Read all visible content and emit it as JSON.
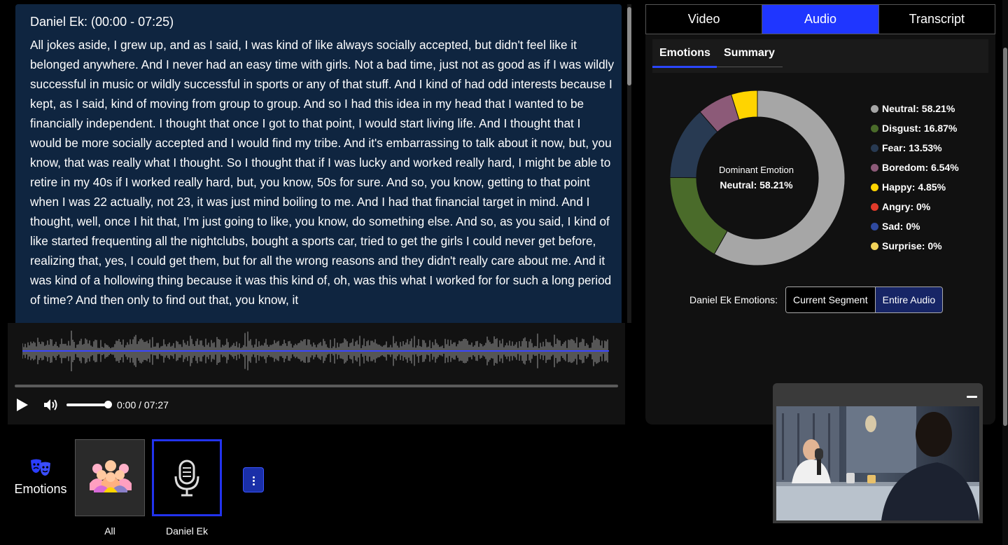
{
  "transcript": {
    "speaker_header": "Daniel Ek: (00:00 - 07:25)",
    "text": "All jokes aside, I grew up, and as I said, I was kind of like always socially accepted, but didn't feel like it belonged anywhere. And I never had an easy time with girls. Not a bad time, just not as good as if I was wildly successful in music or wildly successful in sports or any of that stuff. And I kind of had odd interests because I kept, as I said, kind of moving from group to group. And so I had this idea in my head that I wanted to be financially independent. I thought that once I got to that point, I would start living life. And I thought that I would be more socially accepted and I would find my tribe. And it's embarrassing to talk about it now, but, you know, that was really what I thought. So I thought that if I was lucky and worked really hard, I might be able to retire in my 40s if I worked really hard, but, you know, 50s for sure. And so, you know, getting to that point when I was 22 actually, not 23, it was just mind boiling to me. And I had that financial target in mind. And I thought, well, once I hit that, I'm just going to like, you know, do something else. And so, as you said, I kind of like started frequenting all the nightclubs, bought a sports car, tried to get the girls I could never get before, realizing that, yes, I could get them, but for all the wrong reasons and they didn't really care about me. And it was kind of a hollowing thing because it was this kind of, oh, was this what I worked for for such a long period of time? And then only to find out that, you know, it"
  },
  "player": {
    "time": "0:00 / 07:27",
    "volume_fraction": 1.0,
    "progress_fraction": 0.0
  },
  "bottom": {
    "emotions_label": "Emotions",
    "tiles": [
      {
        "caption": "All",
        "icon": "group-icon",
        "selected": false
      },
      {
        "caption": "Daniel Ek",
        "icon": "microphone-icon",
        "selected": true
      }
    ]
  },
  "right_panel": {
    "tabs": [
      {
        "label": "Video",
        "active": false
      },
      {
        "label": "Audio",
        "active": true
      },
      {
        "label": "Transcript",
        "active": false
      }
    ],
    "subtabs": [
      {
        "label": "Emotions",
        "active": true
      },
      {
        "label": "Summary",
        "active": false
      }
    ],
    "dominant_title": "Dominant Emotion",
    "dominant_value": "Neutral: 58.21%",
    "segment_label": "Daniel Ek Emotions:",
    "segment_buttons": [
      {
        "label": "Current Segment",
        "active": false
      },
      {
        "label": "Entire Audio",
        "active": true
      }
    ]
  },
  "chart_data": {
    "type": "pie",
    "categories": [
      "Neutral",
      "Disgust",
      "Fear",
      "Boredom",
      "Happy",
      "Angry",
      "Sad",
      "Surprise"
    ],
    "values": [
      58.21,
      16.87,
      13.53,
      6.54,
      4.85,
      0,
      0,
      0
    ],
    "labels": [
      "Neutral: 58.21%",
      "Disgust: 16.87%",
      "Fear: 13.53%",
      "Boredom: 6.54%",
      "Happy: 4.85%",
      "Angry: 0%",
      "Sad: 0%",
      "Surprise: 0%"
    ],
    "colors": [
      "#a6a6a6",
      "#4a6b2a",
      "#283a52",
      "#8c5a78",
      "#ffd400",
      "#e03a2a",
      "#2f4aa0",
      "#f2d35a"
    ],
    "legend": "right"
  }
}
